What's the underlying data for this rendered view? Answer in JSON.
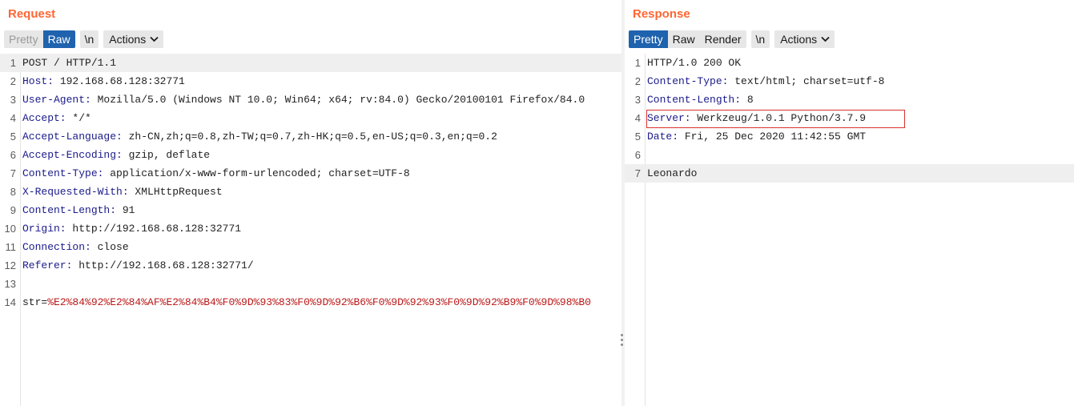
{
  "request": {
    "title": "Request",
    "tabs": [
      {
        "label": "Pretty",
        "state": "disabled"
      },
      {
        "label": "Raw",
        "state": "active"
      }
    ],
    "newline_label": "\\n",
    "actions_label": "Actions",
    "lines": [
      {
        "n": "1",
        "name": "",
        "value": "POST / HTTP/1.1"
      },
      {
        "n": "2",
        "name": "Host:",
        "value": " 192.168.68.128:32771"
      },
      {
        "n": "3",
        "name": "User-Agent:",
        "value": " Mozilla/5.0 (Windows NT 10.0; Win64; x64; rv:84.0) Gecko/20100101 Firefox/84.0"
      },
      {
        "n": "4",
        "name": "Accept:",
        "value": " */*"
      },
      {
        "n": "5",
        "name": "Accept-Language:",
        "value": " zh-CN,zh;q=0.8,zh-TW;q=0.7,zh-HK;q=0.5,en-US;q=0.3,en;q=0.2"
      },
      {
        "n": "6",
        "name": "Accept-Encoding:",
        "value": " gzip, deflate"
      },
      {
        "n": "7",
        "name": "Content-Type:",
        "value": " application/x-www-form-urlencoded; charset=UTF-8"
      },
      {
        "n": "8",
        "name": "X-Requested-With:",
        "value": " XMLHttpRequest"
      },
      {
        "n": "9",
        "name": "Content-Length:",
        "value": " 91"
      },
      {
        "n": "10",
        "name": "Origin:",
        "value": " http://192.168.68.128:32771"
      },
      {
        "n": "11",
        "name": "Connection:",
        "value": " close"
      },
      {
        "n": "12",
        "name": "Referer:",
        "value": " http://192.168.68.128:32771/"
      },
      {
        "n": "13",
        "name": "",
        "value": ""
      },
      {
        "n": "14",
        "name": "",
        "value": "str=",
        "param": "%E2%84%92%E2%84%AF%E2%84%B4%F0%9D%93%83%F0%9D%92%B6%F0%9D%92%93%F0%9D%92%B9%F0%9D%98%B0"
      }
    ]
  },
  "response": {
    "title": "Response",
    "tabs": [
      {
        "label": "Pretty",
        "state": "active"
      },
      {
        "label": "Raw",
        "state": "normal"
      },
      {
        "label": "Render",
        "state": "normal"
      }
    ],
    "newline_label": "\\n",
    "actions_label": "Actions",
    "lines": [
      {
        "n": "1",
        "name": "",
        "value": "HTTP/1.0 200 OK"
      },
      {
        "n": "2",
        "name": "Content-Type:",
        "value": " text/html; charset=utf-8"
      },
      {
        "n": "3",
        "name": "Content-Length:",
        "value": " 8"
      },
      {
        "n": "4",
        "name": "Server:",
        "value": " Werkzeug/1.0.1 Python/3.7.9"
      },
      {
        "n": "5",
        "name": "Date:",
        "value": " Fri, 25 Dec 2020 11:42:55 GMT"
      },
      {
        "n": "6",
        "name": "",
        "value": ""
      },
      {
        "n": "7",
        "name": "",
        "value": "Leonardo"
      }
    ]
  },
  "colors": {
    "accent_title": "#ff6633",
    "active_tab": "#1f62ae",
    "header_name": "#1a1a8c",
    "param_value": "#bb1818",
    "highlight_box": "#d9322e"
  }
}
